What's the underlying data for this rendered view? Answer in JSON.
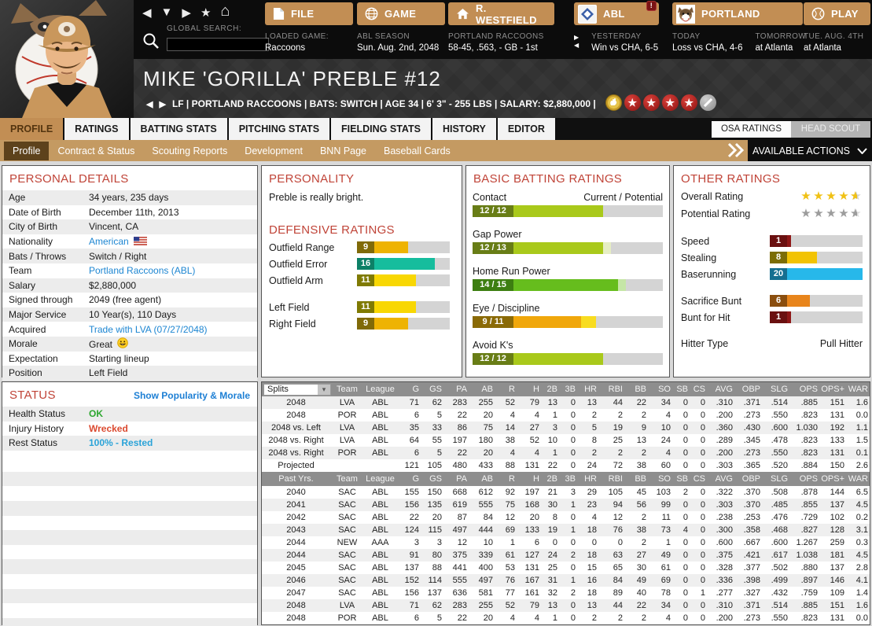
{
  "topbar": {
    "search_label": "GLOBAL SEARCH:",
    "search_value": "",
    "menus": [
      {
        "label": "FILE",
        "sub_label": "LOADED GAME:",
        "sub_value": "Raccoons"
      },
      {
        "label": "GAME",
        "sub_label": "ABL SEASON",
        "sub_value": "Sun. Aug. 2nd, 2048"
      },
      {
        "label": "R. WESTFIELD",
        "sub_label": "PORTLAND RACCOONS",
        "sub_value": "58-45, .563, - GB - 1st"
      },
      {
        "label": "ABL",
        "badge": "!",
        "sub_label": "YESTERDAY",
        "sub_value": "Win vs CHA, 6-5"
      },
      {
        "label": "PORTLAND",
        "sub_label": "TODAY",
        "sub_value": "Loss vs CHA, 4-6",
        "sub_label2": "TOMORROW",
        "sub_value2": "at Atlanta"
      },
      {
        "label": "PLAY",
        "sub_label": "TUE. AUG. 4TH",
        "sub_value": "at Atlanta"
      }
    ]
  },
  "header": {
    "name": "MIKE 'GORILLA' PREBLE  #12",
    "info": "LF | PORTLAND RACCOONS  |  BATS: SWITCH  |  AGE 34  |  6' 3\" - 255 LBS  |  SALARY: $2,880,000  |",
    "badges": [
      "gold-glove",
      "star",
      "star",
      "star",
      "star",
      "none"
    ]
  },
  "tabs": {
    "items": [
      "PROFILE",
      "RATINGS",
      "BATTING STATS",
      "PITCHING STATS",
      "FIELDING STATS",
      "HISTORY",
      "EDITOR"
    ],
    "active_index": 0
  },
  "subtabs": {
    "items": [
      "Profile",
      "Contract & Status",
      "Scouting Reports",
      "Development",
      "BNN Page",
      "Baseball Cards"
    ],
    "active_index": 0
  },
  "toggles": {
    "items": [
      "OSA RATINGS",
      "HEAD SCOUT"
    ],
    "active_index": 0
  },
  "actions": {
    "label": "AVAILABLE ACTIONS"
  },
  "panels": {
    "personal_details_title": "PERSONAL DETAILS",
    "personality_title": "PERSONALITY",
    "defensive_title": "DEFENSIVE RATINGS",
    "batting_title": "BASIC BATTING RATINGS",
    "other_title": "OTHER RATINGS",
    "status_title": "STATUS"
  },
  "personal_details": {
    "rows": [
      {
        "label": "Age",
        "value": "34 years, 235 days"
      },
      {
        "label": "Date of Birth",
        "value": "December 11th, 2013"
      },
      {
        "label": "City of Birth",
        "value": "Vincent, CA"
      },
      {
        "label": "Nationality",
        "value": "American",
        "type": "flag-link"
      },
      {
        "label": "Bats / Throws",
        "value": "Switch / Right"
      },
      {
        "label": "Team",
        "value": "Portland Raccoons (ABL)",
        "type": "link"
      },
      {
        "label": "Salary",
        "value": "$2,880,000"
      },
      {
        "label": "Signed through",
        "value": "2049 (free agent)"
      },
      {
        "label": "Major Service",
        "value": "10 Year(s), 110 Days"
      },
      {
        "label": "Acquired",
        "value": "Trade with LVA (07/27/2048)",
        "type": "link"
      },
      {
        "label": "Morale",
        "value": "Great",
        "type": "morale"
      },
      {
        "label": "Expectation",
        "value": "Starting lineup"
      },
      {
        "label": "Position",
        "value": "Left Field"
      }
    ]
  },
  "personality": {
    "text": "Preble is really bright."
  },
  "defensive_ratings": [
    {
      "label": "Outfield Range",
      "value": 9,
      "fill": "#eeb302",
      "box": "#806a08"
    },
    {
      "label": "Outfield Error",
      "value": 16,
      "fill": "#16bd9d",
      "box": "#0d8066"
    },
    {
      "label": "Outfield Arm",
      "value": 11,
      "fill": "#f8d703",
      "box": "#7f7a03"
    },
    {
      "spacer": true
    },
    {
      "label": "Left Field",
      "value": 11,
      "fill": "#f8d703",
      "box": "#7f7a03"
    },
    {
      "label": "Right Field",
      "value": 9,
      "fill": "#eeb302",
      "box": "#806a08"
    }
  ],
  "batting": {
    "header_right": "Current / Potential",
    "ratings": [
      {
        "label": "Contact",
        "current": 12,
        "potential": 12,
        "fill": "#a9c91b",
        "pot": "#cfe08c",
        "box": "#687d16"
      },
      {
        "label": "Gap Power",
        "current": 12,
        "potential": 13,
        "fill": "#a9c91b",
        "pot": "#e6eec4",
        "box": "#687d16"
      },
      {
        "label": "Home Run Power",
        "current": 14,
        "potential": 15,
        "fill": "#66bd1d",
        "pot": "#c5e6a6",
        "box": "#3d7e11"
      },
      {
        "label": "Eye / Discipline",
        "current": 9,
        "potential": 11,
        "fill": "#f0a70b",
        "pot": "#f8dc20",
        "box": "#8a6a06"
      },
      {
        "label": "Avoid K's",
        "current": 12,
        "potential": 12,
        "fill": "#a9c91b",
        "pot": "#cfe08c",
        "box": "#687d16"
      }
    ]
  },
  "other": {
    "overall_label": "Overall Rating",
    "potential_label": "Potential Rating",
    "overall_stars": 4.5,
    "potential_stars": 4.5,
    "overall_star_color": "#f0c114",
    "potential_star_color": "#9c9c9c",
    "bars1": [
      {
        "label": "Speed",
        "value": 1,
        "fill": "#8e1717",
        "box": "#6a1010"
      },
      {
        "label": "Stealing",
        "value": 8,
        "fill": "#f2c304",
        "box": "#7c6d06"
      },
      {
        "label": "Baserunning",
        "value": 20,
        "fill": "#27b8ea",
        "box": "#156f91"
      }
    ],
    "bars2": [
      {
        "label": "Sacrifice Bunt",
        "value": 6,
        "fill": "#e8851c",
        "box": "#8a4e0e"
      },
      {
        "label": "Bunt for Hit",
        "value": 1,
        "fill": "#8e1717",
        "box": "#6a1010"
      }
    ],
    "hitter_type_label": "Hitter Type",
    "hitter_type_value": "Pull Hitter"
  },
  "status": {
    "link": "Show Popularity & Morale",
    "rows": [
      {
        "label": "Health Status",
        "value": "OK",
        "color": "#2ca62e"
      },
      {
        "label": "Injury History",
        "value": "Wrecked",
        "color": "#db4a30"
      },
      {
        "label": "Rest Status",
        "value": "100% - Rested",
        "color": "#2aa3d8"
      }
    ]
  },
  "stats": {
    "dropdown_value": "Splits",
    "past_header": "Past Yrs.",
    "columns": [
      "Team",
      "League",
      "G",
      "GS",
      "PA",
      "AB",
      "R",
      "H",
      "2B",
      "3B",
      "HR",
      "RBI",
      "BB",
      "SO",
      "SB",
      "CS",
      "AVG",
      "OBP",
      "SLG",
      "OPS",
      "OPS+",
      "WAR"
    ],
    "splits_rows": [
      [
        "2048",
        "LVA",
        "ABL",
        "71",
        "62",
        "283",
        "255",
        "52",
        "79",
        "13",
        "0",
        "13",
        "44",
        "22",
        "34",
        "0",
        "0",
        ".310",
        ".371",
        ".514",
        ".885",
        "151",
        "1.6"
      ],
      [
        "2048",
        "POR",
        "ABL",
        "6",
        "5",
        "22",
        "20",
        "4",
        "4",
        "1",
        "0",
        "2",
        "2",
        "2",
        "4",
        "0",
        "0",
        ".200",
        ".273",
        ".550",
        ".823",
        "131",
        "0.0"
      ],
      [
        "2048 vs. Left",
        "LVA",
        "ABL",
        "35",
        "33",
        "86",
        "75",
        "14",
        "27",
        "3",
        "0",
        "5",
        "19",
        "9",
        "10",
        "0",
        "0",
        ".360",
        ".430",
        ".600",
        "1.030",
        "192",
        "1.1"
      ],
      [
        "2048 vs. Right",
        "LVA",
        "ABL",
        "64",
        "55",
        "197",
        "180",
        "38",
        "52",
        "10",
        "0",
        "8",
        "25",
        "13",
        "24",
        "0",
        "0",
        ".289",
        ".345",
        ".478",
        ".823",
        "133",
        "1.5"
      ],
      [
        "2048 vs. Right",
        "POR",
        "ABL",
        "6",
        "5",
        "22",
        "20",
        "4",
        "4",
        "1",
        "0",
        "2",
        "2",
        "2",
        "4",
        "0",
        "0",
        ".200",
        ".273",
        ".550",
        ".823",
        "131",
        "0.1"
      ],
      [
        "Projected",
        "",
        "",
        "121",
        "105",
        "480",
        "433",
        "88",
        "131",
        "22",
        "0",
        "24",
        "72",
        "38",
        "60",
        "0",
        "0",
        ".303",
        ".365",
        ".520",
        ".884",
        "150",
        "2.6"
      ]
    ],
    "past_rows": [
      [
        "2040",
        "SAC",
        "ABL",
        "155",
        "150",
        "668",
        "612",
        "92",
        "197",
        "21",
        "3",
        "29",
        "105",
        "45",
        "103",
        "2",
        "0",
        ".322",
        ".370",
        ".508",
        ".878",
        "144",
        "6.5"
      ],
      [
        "2041",
        "SAC",
        "ABL",
        "156",
        "135",
        "619",
        "555",
        "75",
        "168",
        "30",
        "1",
        "23",
        "94",
        "56",
        "99",
        "0",
        "0",
        ".303",
        ".370",
        ".485",
        ".855",
        "137",
        "4.5"
      ],
      [
        "2042",
        "SAC",
        "ABL",
        "22",
        "20",
        "87",
        "84",
        "12",
        "20",
        "8",
        "0",
        "4",
        "12",
        "2",
        "11",
        "0",
        "0",
        ".238",
        ".253",
        ".476",
        ".729",
        "102",
        "0.2"
      ],
      [
        "2043",
        "SAC",
        "ABL",
        "124",
        "115",
        "497",
        "444",
        "69",
        "133",
        "19",
        "1",
        "18",
        "76",
        "38",
        "73",
        "4",
        "0",
        ".300",
        ".358",
        ".468",
        ".827",
        "128",
        "3.1"
      ],
      [
        "2044",
        "NEW",
        "AAA",
        "3",
        "3",
        "12",
        "10",
        "1",
        "6",
        "0",
        "0",
        "0",
        "0",
        "2",
        "1",
        "0",
        "0",
        ".600",
        ".667",
        ".600",
        "1.267",
        "259",
        "0.3"
      ],
      [
        "2044",
        "SAC",
        "ABL",
        "91",
        "80",
        "375",
        "339",
        "61",
        "127",
        "24",
        "2",
        "18",
        "63",
        "27",
        "49",
        "0",
        "0",
        ".375",
        ".421",
        ".617",
        "1.038",
        "181",
        "4.5"
      ],
      [
        "2045",
        "SAC",
        "ABL",
        "137",
        "88",
        "441",
        "400",
        "53",
        "131",
        "25",
        "0",
        "15",
        "65",
        "30",
        "61",
        "0",
        "0",
        ".328",
        ".377",
        ".502",
        ".880",
        "137",
        "2.8"
      ],
      [
        "2046",
        "SAC",
        "ABL",
        "152",
        "114",
        "555",
        "497",
        "76",
        "167",
        "31",
        "1",
        "16",
        "84",
        "49",
        "69",
        "0",
        "0",
        ".336",
        ".398",
        ".499",
        ".897",
        "146",
        "4.1"
      ],
      [
        "2047",
        "SAC",
        "ABL",
        "156",
        "137",
        "636",
        "581",
        "77",
        "161",
        "32",
        "2",
        "18",
        "89",
        "40",
        "78",
        "0",
        "1",
        ".277",
        ".327",
        ".432",
        ".759",
        "109",
        "1.4"
      ],
      [
        "2048",
        "LVA",
        "ABL",
        "71",
        "62",
        "283",
        "255",
        "52",
        "79",
        "13",
        "0",
        "13",
        "44",
        "22",
        "34",
        "0",
        "0",
        ".310",
        ".371",
        ".514",
        ".885",
        "151",
        "1.6"
      ],
      [
        "2048",
        "POR",
        "ABL",
        "6",
        "5",
        "22",
        "20",
        "4",
        "4",
        "1",
        "0",
        "2",
        "2",
        "2",
        "4",
        "0",
        "0",
        ".200",
        ".273",
        ".550",
        ".823",
        "131",
        "0.0"
      ]
    ]
  }
}
